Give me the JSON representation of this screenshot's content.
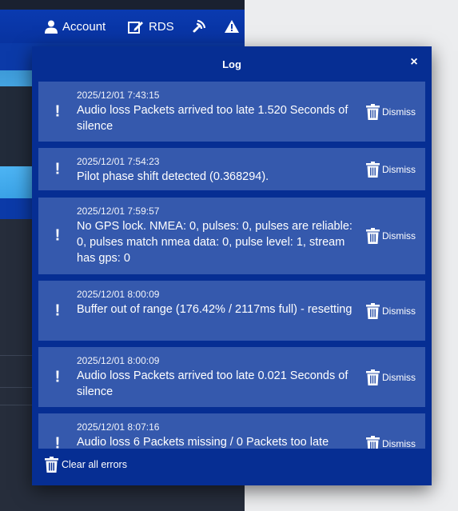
{
  "topbar": {
    "account_label": "Account",
    "rds_label": "RDS",
    "icons": [
      "user-icon",
      "edit-icon",
      "broadcast-icon",
      "warning-icon"
    ]
  },
  "log": {
    "title": "Log",
    "close_symbol": "×",
    "dismiss_label": "Dismiss",
    "clear_label": "Clear all errors",
    "entries": [
      {
        "timestamp": "2025/12/01 7:43:15",
        "message": "Audio loss Packets arrived too late 1.520 Seconds of silence"
      },
      {
        "timestamp": "2025/12/01 7:54:23",
        "message": "Pilot phase shift detected (0.368294)."
      },
      {
        "timestamp": "2025/12/01 7:59:57",
        "message": "No GPS lock. NMEA: 0, pulses: 0, pulses are reliable: 0, pulses match nmea data: 0, pulse level: 1, stream has gps: 0"
      },
      {
        "timestamp": "2025/12/01 8:00:09",
        "message": "Buffer out of range (176.42% / 2117ms full) - resetting"
      },
      {
        "timestamp": "2025/12/01 8:00:09",
        "message": "Audio loss Packets arrived too late 0.021 Seconds of silence"
      },
      {
        "timestamp": "2025/12/01 8:07:16",
        "message": "Audio loss 6 Packets missing / 0 Packets too late"
      }
    ]
  },
  "colors": {
    "modal_bg": "#062e93",
    "entry_bg": "#3559ad",
    "topbar_bg": "#0a3ab0"
  }
}
